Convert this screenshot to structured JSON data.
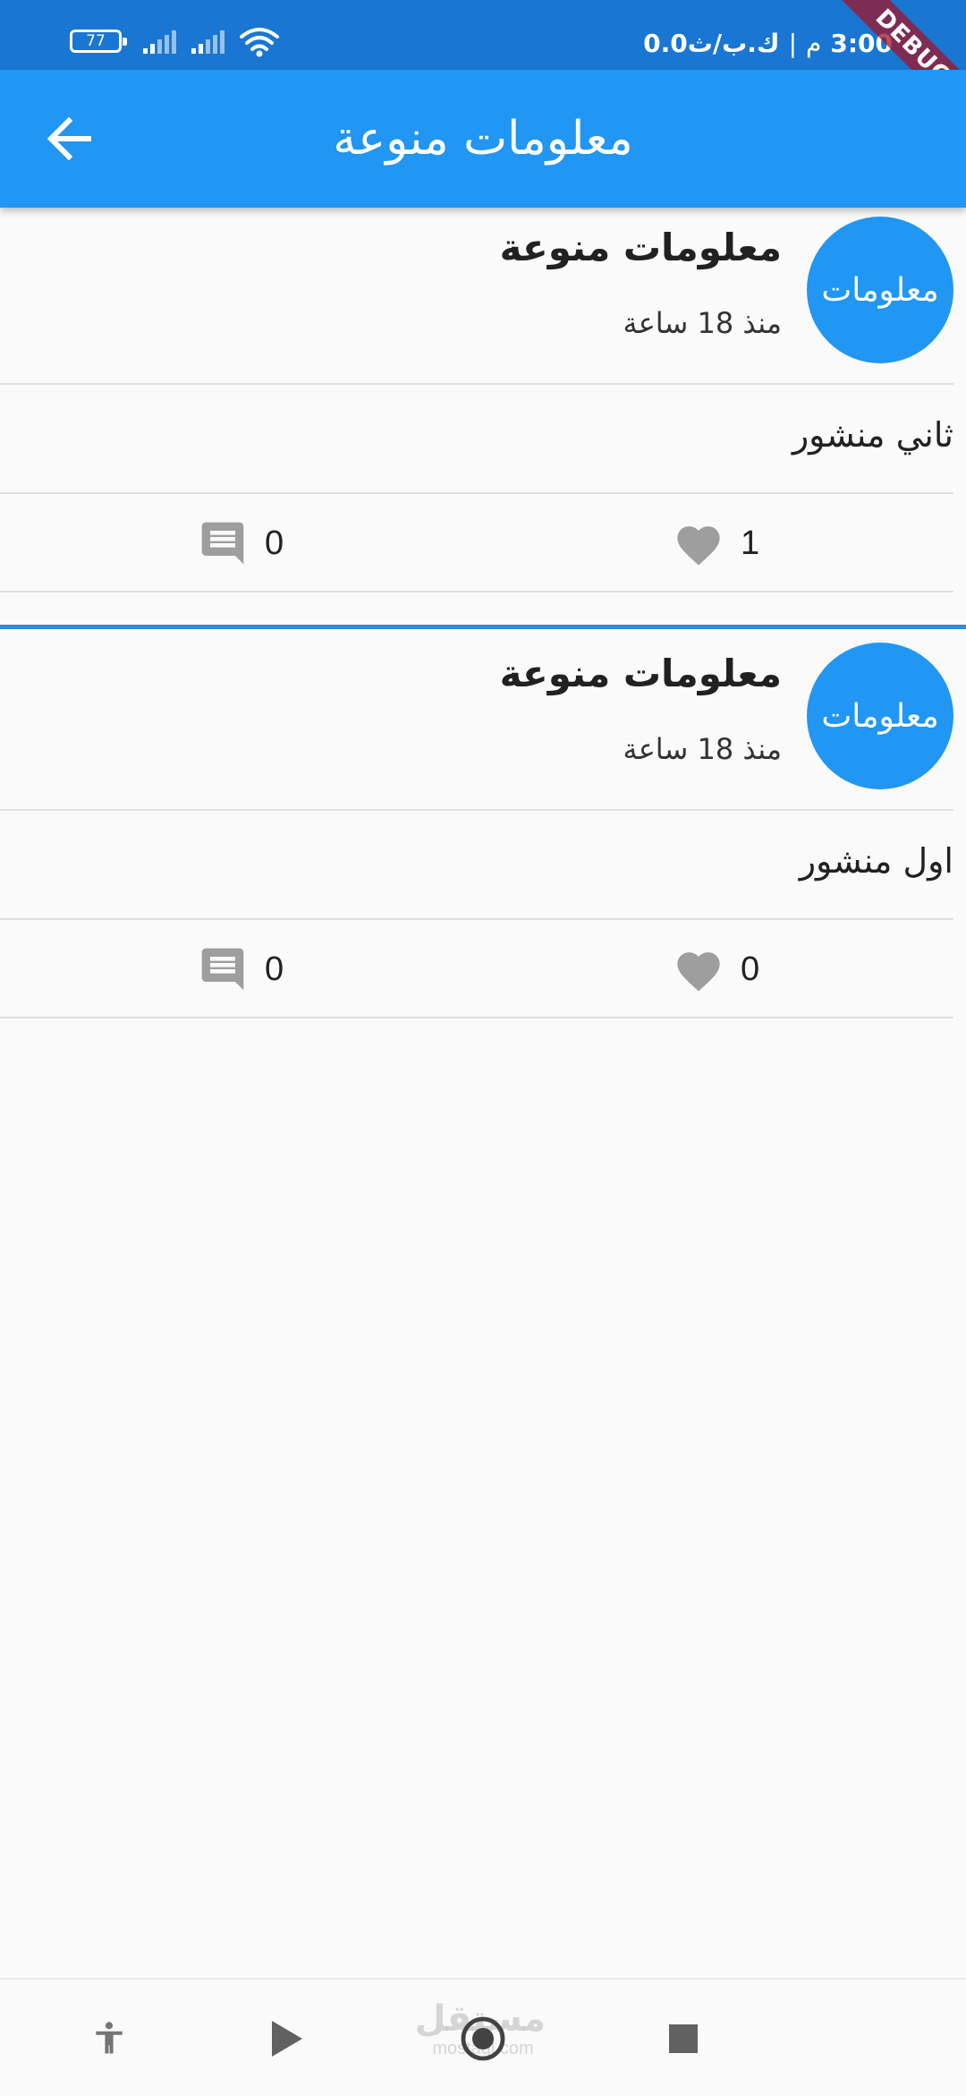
{
  "status_bar": {
    "time": "3:00",
    "ampm": "م",
    "separator": "|",
    "data_speed": "0.0ك.ب/ث",
    "battery_level": "77",
    "debug_label": "DEBUG"
  },
  "app_bar": {
    "title": "معلومات منوعة",
    "back_icon": "arrow-back-icon"
  },
  "posts": [
    {
      "avatar_text": "معلومات",
      "author": "معلومات منوعة",
      "time": "منذ 18 ساعة",
      "body": "ثاني منشور",
      "likes": "1",
      "comments": "0"
    },
    {
      "avatar_text": "معلومات",
      "author": "معلومات منوعة",
      "time": "منذ 18 ساعة",
      "body": "اول منشور",
      "likes": "0",
      "comments": "0"
    }
  ],
  "bottom_nav": {
    "icons": [
      "accessibility-icon",
      "play-icon",
      "home-circle-icon",
      "stop-icon"
    ],
    "watermark_ar": "مستقل",
    "watermark_en": "mostaql.com"
  },
  "colors": {
    "status_bar": "#1976d2",
    "app_bar": "#2196f3",
    "avatar": "#2196f3",
    "icon_grey": "#9e9e9e",
    "separator": "#2a8ee0"
  }
}
